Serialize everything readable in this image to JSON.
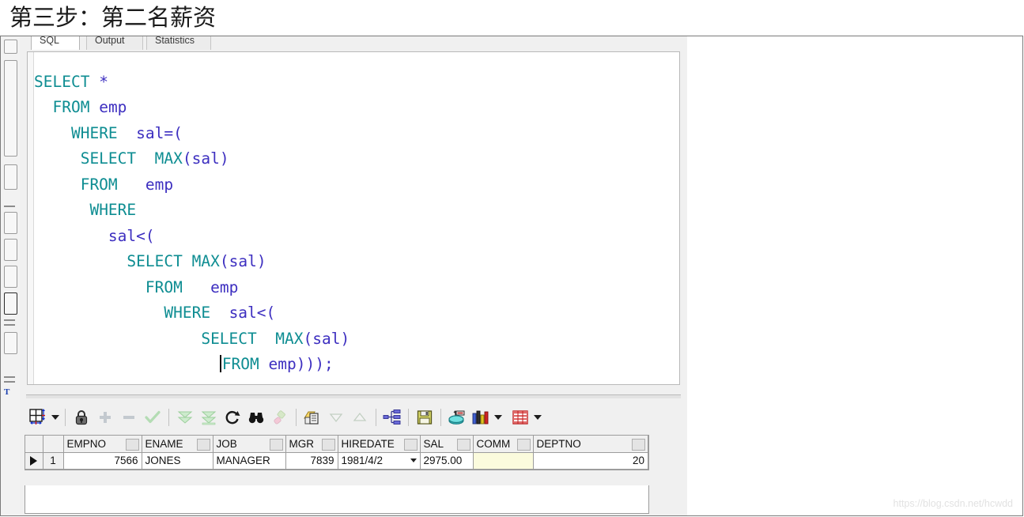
{
  "page": {
    "title": "第三步：第二名薪资",
    "watermark": "https://blog.csdn.net/hcwdd"
  },
  "editor": {
    "tabs": [
      {
        "label": "SQL",
        "active": true
      },
      {
        "label": "Output",
        "active": false
      },
      {
        "label": "Statistics",
        "active": false
      }
    ],
    "sql_lines": [
      "SELECT *",
      "  FROM emp",
      "    WHERE  sal=(",
      "     SELECT  MAX(sal)",
      "     FROM   emp",
      "      WHERE",
      "        sal<(",
      "          SELECT MAX(sal)",
      "            FROM   emp",
      "              WHERE  sal<(",
      "                  SELECT  MAX(sal)",
      "                    FROM emp)));"
    ],
    "caret_line": 11,
    "colors": {
      "keyword": "#0e8d92",
      "identifier": "#3d2fc0",
      "background": "#ffffff"
    }
  },
  "toolbar": {
    "items": [
      {
        "name": "grid-layout-icon",
        "label": "Grid"
      },
      {
        "name": "grid-layout-dropdown",
        "label": "Grid options"
      },
      {
        "name": "lock-icon",
        "label": "Lock"
      },
      {
        "name": "insert-row-icon",
        "label": "Insert record"
      },
      {
        "name": "delete-row-icon",
        "label": "Delete record"
      },
      {
        "name": "post-changes-icon",
        "label": "Post changes"
      },
      {
        "name": "fetch-next-page-icon",
        "label": "Fetch next page"
      },
      {
        "name": "fetch-last-page-icon",
        "label": "Fetch last page"
      },
      {
        "name": "refresh-icon",
        "label": "Refresh"
      },
      {
        "name": "find-icon",
        "label": "Find"
      },
      {
        "name": "clear-filter-icon",
        "label": "Clear filter"
      },
      {
        "name": "copy-to-clipboard-icon",
        "label": "Copy to clipboard"
      },
      {
        "name": "sort-descending-icon",
        "label": "Sort descending"
      },
      {
        "name": "sort-ascending-icon",
        "label": "Sort ascending"
      },
      {
        "name": "query-builder-icon",
        "label": "Query builder"
      },
      {
        "name": "save-icon",
        "label": "Save"
      },
      {
        "name": "export-data-icon",
        "label": "Export data"
      },
      {
        "name": "chart-icon",
        "label": "Chart"
      },
      {
        "name": "chart-dropdown",
        "label": "Chart options"
      },
      {
        "name": "report-icon",
        "label": "Report"
      },
      {
        "name": "report-dropdown",
        "label": "Report options"
      }
    ]
  },
  "results": {
    "columns": [
      "EMPNO",
      "ENAME",
      "JOB",
      "MGR",
      "HIREDATE",
      "SAL",
      "COMM",
      "DEPTNO"
    ],
    "rows": [
      {
        "row_number": "1",
        "selected": true,
        "EMPNO": "7566",
        "ENAME": "JONES",
        "JOB": "MANAGER",
        "MGR": "7839",
        "HIREDATE": "1981/4/2",
        "SAL": "2975.00",
        "COMM": "",
        "DEPTNO": "20"
      }
    ],
    "highlight_color": "#fbfbdd"
  }
}
